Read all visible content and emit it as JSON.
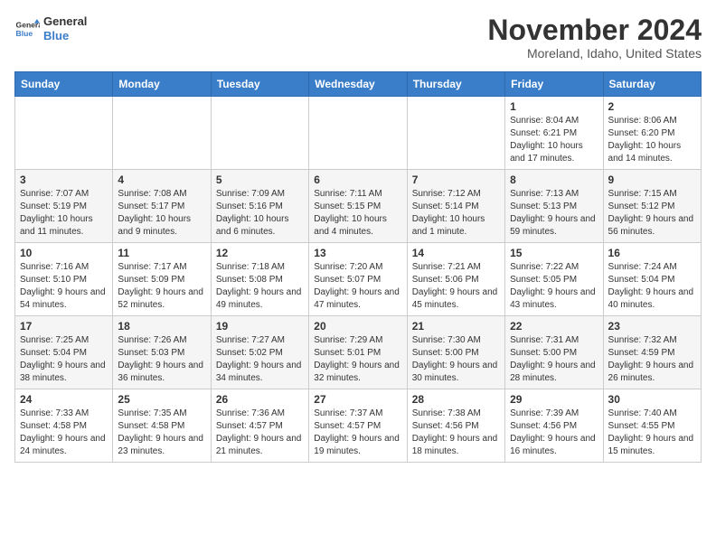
{
  "header": {
    "logo_line1": "General",
    "logo_line2": "Blue",
    "title": "November 2024",
    "subtitle": "Moreland, Idaho, United States"
  },
  "weekdays": [
    "Sunday",
    "Monday",
    "Tuesday",
    "Wednesday",
    "Thursday",
    "Friday",
    "Saturday"
  ],
  "weeks": [
    [
      {
        "day": "",
        "info": ""
      },
      {
        "day": "",
        "info": ""
      },
      {
        "day": "",
        "info": ""
      },
      {
        "day": "",
        "info": ""
      },
      {
        "day": "",
        "info": ""
      },
      {
        "day": "1",
        "info": "Sunrise: 8:04 AM\nSunset: 6:21 PM\nDaylight: 10 hours and 17 minutes."
      },
      {
        "day": "2",
        "info": "Sunrise: 8:06 AM\nSunset: 6:20 PM\nDaylight: 10 hours and 14 minutes."
      }
    ],
    [
      {
        "day": "3",
        "info": "Sunrise: 7:07 AM\nSunset: 5:19 PM\nDaylight: 10 hours and 11 minutes."
      },
      {
        "day": "4",
        "info": "Sunrise: 7:08 AM\nSunset: 5:17 PM\nDaylight: 10 hours and 9 minutes."
      },
      {
        "day": "5",
        "info": "Sunrise: 7:09 AM\nSunset: 5:16 PM\nDaylight: 10 hours and 6 minutes."
      },
      {
        "day": "6",
        "info": "Sunrise: 7:11 AM\nSunset: 5:15 PM\nDaylight: 10 hours and 4 minutes."
      },
      {
        "day": "7",
        "info": "Sunrise: 7:12 AM\nSunset: 5:14 PM\nDaylight: 10 hours and 1 minute."
      },
      {
        "day": "8",
        "info": "Sunrise: 7:13 AM\nSunset: 5:13 PM\nDaylight: 9 hours and 59 minutes."
      },
      {
        "day": "9",
        "info": "Sunrise: 7:15 AM\nSunset: 5:12 PM\nDaylight: 9 hours and 56 minutes."
      }
    ],
    [
      {
        "day": "10",
        "info": "Sunrise: 7:16 AM\nSunset: 5:10 PM\nDaylight: 9 hours and 54 minutes."
      },
      {
        "day": "11",
        "info": "Sunrise: 7:17 AM\nSunset: 5:09 PM\nDaylight: 9 hours and 52 minutes."
      },
      {
        "day": "12",
        "info": "Sunrise: 7:18 AM\nSunset: 5:08 PM\nDaylight: 9 hours and 49 minutes."
      },
      {
        "day": "13",
        "info": "Sunrise: 7:20 AM\nSunset: 5:07 PM\nDaylight: 9 hours and 47 minutes."
      },
      {
        "day": "14",
        "info": "Sunrise: 7:21 AM\nSunset: 5:06 PM\nDaylight: 9 hours and 45 minutes."
      },
      {
        "day": "15",
        "info": "Sunrise: 7:22 AM\nSunset: 5:05 PM\nDaylight: 9 hours and 43 minutes."
      },
      {
        "day": "16",
        "info": "Sunrise: 7:24 AM\nSunset: 5:04 PM\nDaylight: 9 hours and 40 minutes."
      }
    ],
    [
      {
        "day": "17",
        "info": "Sunrise: 7:25 AM\nSunset: 5:04 PM\nDaylight: 9 hours and 38 minutes."
      },
      {
        "day": "18",
        "info": "Sunrise: 7:26 AM\nSunset: 5:03 PM\nDaylight: 9 hours and 36 minutes."
      },
      {
        "day": "19",
        "info": "Sunrise: 7:27 AM\nSunset: 5:02 PM\nDaylight: 9 hours and 34 minutes."
      },
      {
        "day": "20",
        "info": "Sunrise: 7:29 AM\nSunset: 5:01 PM\nDaylight: 9 hours and 32 minutes."
      },
      {
        "day": "21",
        "info": "Sunrise: 7:30 AM\nSunset: 5:00 PM\nDaylight: 9 hours and 30 minutes."
      },
      {
        "day": "22",
        "info": "Sunrise: 7:31 AM\nSunset: 5:00 PM\nDaylight: 9 hours and 28 minutes."
      },
      {
        "day": "23",
        "info": "Sunrise: 7:32 AM\nSunset: 4:59 PM\nDaylight: 9 hours and 26 minutes."
      }
    ],
    [
      {
        "day": "24",
        "info": "Sunrise: 7:33 AM\nSunset: 4:58 PM\nDaylight: 9 hours and 24 minutes."
      },
      {
        "day": "25",
        "info": "Sunrise: 7:35 AM\nSunset: 4:58 PM\nDaylight: 9 hours and 23 minutes."
      },
      {
        "day": "26",
        "info": "Sunrise: 7:36 AM\nSunset: 4:57 PM\nDaylight: 9 hours and 21 minutes."
      },
      {
        "day": "27",
        "info": "Sunrise: 7:37 AM\nSunset: 4:57 PM\nDaylight: 9 hours and 19 minutes."
      },
      {
        "day": "28",
        "info": "Sunrise: 7:38 AM\nSunset: 4:56 PM\nDaylight: 9 hours and 18 minutes."
      },
      {
        "day": "29",
        "info": "Sunrise: 7:39 AM\nSunset: 4:56 PM\nDaylight: 9 hours and 16 minutes."
      },
      {
        "day": "30",
        "info": "Sunrise: 7:40 AM\nSunset: 4:55 PM\nDaylight: 9 hours and 15 minutes."
      }
    ]
  ]
}
